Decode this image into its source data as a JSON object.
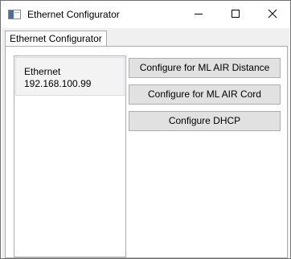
{
  "window": {
    "title": "Ethernet Configurator"
  },
  "tabs": [
    {
      "label": "Ethernet Configurator",
      "selected": true
    }
  ],
  "adapters": [
    {
      "name": "Ethernet",
      "ip": "192.168.100.99",
      "selected": true
    }
  ],
  "actions": {
    "distance_label": "Configure for ML AIR Distance",
    "cord_label": "Configure for ML AIR Cord",
    "dhcp_label": "Configure DHCP"
  },
  "icons": {
    "app": "window-app-icon",
    "minimize": "minimize-icon",
    "maximize": "maximize-icon",
    "close": "close-icon"
  },
  "colors": {
    "window_bg": "#f0f0f0",
    "button_bg": "#e1e1e1",
    "button_border": "#adadad",
    "selection_bg": "#f3f3f3"
  }
}
